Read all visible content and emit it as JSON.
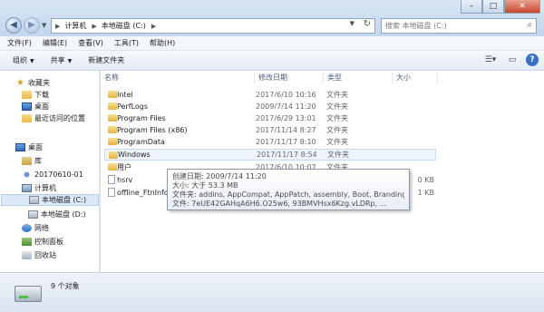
{
  "address": {
    "crumbs": [
      "计算机",
      "本地磁盘 (C:)"
    ]
  },
  "search": {
    "placeholder": "搜索 本地磁盘 (C:)"
  },
  "menu": [
    "文件(F)",
    "编辑(E)",
    "查看(V)",
    "工具(T)",
    "帮助(H)"
  ],
  "toolbar": {
    "organize": "组织",
    "share": "共享",
    "new_folder": "新建文件夹"
  },
  "nav": {
    "favorites": "收藏夹",
    "downloads": "下载",
    "desktop": "桌面",
    "recent": "最近访问的位置",
    "desktop_root": "桌面",
    "library": "库",
    "user": "20170610-01",
    "computer": "计算机",
    "drive_c": "本地磁盘 (C:)",
    "drive_d": "本地磁盘 (D:)",
    "network": "网络",
    "control_panel": "控制面板",
    "recycle_bin": "回收站"
  },
  "columns": {
    "name": "名称",
    "date": "修改日期",
    "type": "类型",
    "size": "大小"
  },
  "files": [
    {
      "name": "Intel",
      "date": "2017/6/10 10:16",
      "type": "文件夹",
      "size": ""
    },
    {
      "name": "PerfLogs",
      "date": "2009/7/14 11:20",
      "type": "文件夹",
      "size": ""
    },
    {
      "name": "Program Files",
      "date": "2017/6/29 13:01",
      "type": "文件夹",
      "size": ""
    },
    {
      "name": "Program Files (x86)",
      "date": "2017/11/14 8:27",
      "type": "文件夹",
      "size": ""
    },
    {
      "name": "ProgramData",
      "date": "2017/11/17 8:10",
      "type": "文件夹",
      "size": ""
    },
    {
      "name": "Windows",
      "date": "2017/11/17 8:54",
      "type": "文件夹",
      "size": ""
    },
    {
      "name": "用户",
      "date": "2017/6/10 10:07",
      "type": "文件夹",
      "size": ""
    },
    {
      "name": "hsrv",
      "date": "",
      "type": "",
      "size": "0 KB"
    },
    {
      "name": "offline_FtnInfo",
      "date": "",
      "type": "",
      "size": "1 KB"
    }
  ],
  "tooltip": {
    "created": "创建日期: 2009/7/14 11:20",
    "size": "大小: 大于 53.3 MB",
    "folders": "文件夹: addins, AppCompat, AppPatch, assembly, Boot, Branding, ...",
    "files": "文件: 7eUE42GAHqA6H6.O25w6, 93BMVHsx6Kzg.vLDRp, ..."
  },
  "status": {
    "count": "9 个对象"
  }
}
